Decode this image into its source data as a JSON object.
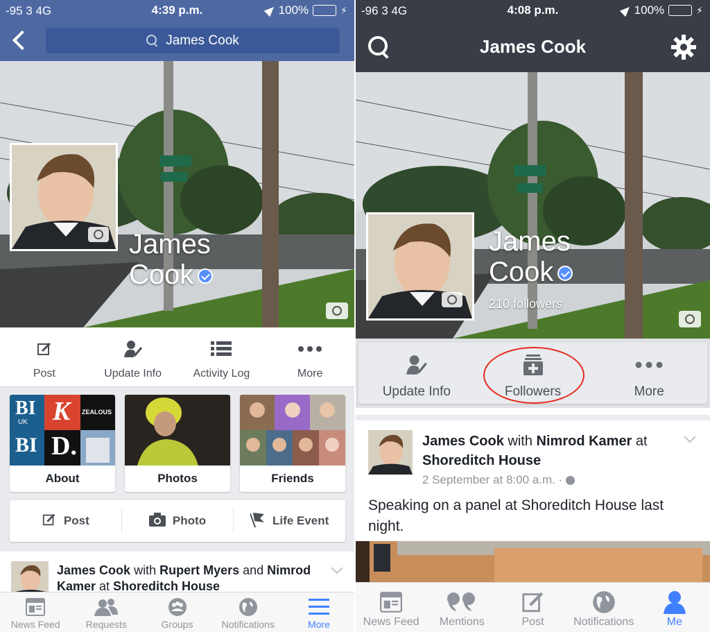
{
  "left": {
    "status": {
      "carrier": "-95 3   4G",
      "time": "4:39 p.m.",
      "battery": "100%"
    },
    "search": {
      "text": "James Cook"
    },
    "cover": {
      "name_line1": "James",
      "name_line2": "Cook"
    },
    "actions": [
      {
        "label": "Post",
        "icon": "edit-icon"
      },
      {
        "label": "Update Info",
        "icon": "person-edit-icon"
      },
      {
        "label": "Activity Log",
        "icon": "list-icon"
      },
      {
        "label": "More",
        "icon": "more-dots-icon"
      }
    ],
    "cards": [
      {
        "label": "About"
      },
      {
        "label": "Photos"
      },
      {
        "label": "Friends"
      }
    ],
    "about_logos": {
      "bi": "BI",
      "uk": "UK",
      "k": "K",
      "zealous": "ZEALOUS",
      "d": "D."
    },
    "composer": [
      {
        "label": "Post",
        "icon": "edit-icon"
      },
      {
        "label": "Photo",
        "icon": "camera-icon"
      },
      {
        "label": "Life Event",
        "icon": "flag-icon"
      }
    ],
    "feed": {
      "author": "James Cook",
      "with": " with ",
      "friend1": "Rupert Myers",
      "and": " and ",
      "friend2": "Nimrod Kamer",
      "at": " at ",
      "place": "Shoreditch House"
    },
    "tabs": [
      {
        "label": "News Feed",
        "icon": "news-feed-icon"
      },
      {
        "label": "Requests",
        "icon": "friend-requests-icon"
      },
      {
        "label": "Groups",
        "icon": "groups-icon"
      },
      {
        "label": "Notifications",
        "icon": "globe-icon"
      },
      {
        "label": "More",
        "icon": "menu-icon",
        "active": true
      }
    ]
  },
  "right": {
    "status": {
      "carrier": "-96 3   4G",
      "time": "4:08 p.m.",
      "battery": "100%"
    },
    "header": {
      "title": "James Cook"
    },
    "cover": {
      "name_line1": "James",
      "name_line2": "Cook",
      "followers": "210 followers"
    },
    "actions": [
      {
        "label": "Update Info",
        "icon": "person-edit-icon"
      },
      {
        "label": "Followers",
        "icon": "followers-icon"
      },
      {
        "label": "More",
        "icon": "more-dots-icon"
      }
    ],
    "post": {
      "author": "James Cook",
      "with": " with ",
      "friend": "Nimrod Kamer",
      "at": " at ",
      "place": "Shoreditch House",
      "timestamp": "2 September at 8:00 a.m. · ",
      "body": "Speaking on a panel at Shoreditch House last night."
    },
    "tabs": [
      {
        "label": "News Feed",
        "icon": "news-feed-icon"
      },
      {
        "label": "Mentions",
        "icon": "quote-icon"
      },
      {
        "label": "Post",
        "icon": "compose-icon"
      },
      {
        "label": "Notifications",
        "icon": "globe-icon"
      },
      {
        "label": "Me",
        "icon": "person-icon",
        "active": true
      }
    ]
  },
  "colors": {
    "left_header": "#4e69a2",
    "right_header": "#383d46",
    "accent": "#4080ff",
    "annotation_circle": "#e52a1c"
  }
}
